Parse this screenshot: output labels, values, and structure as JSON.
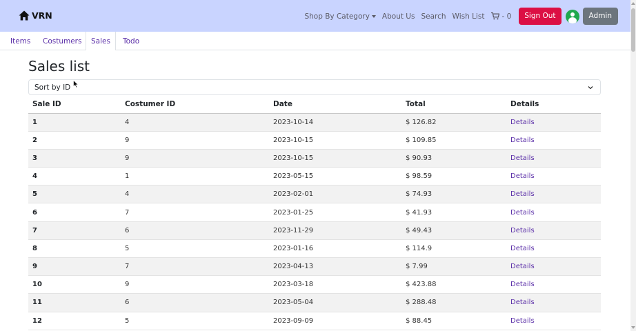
{
  "navbar": {
    "brand": "VRN",
    "shop_by_category": "Shop By Category",
    "about_us": "About Us",
    "search": "Search",
    "wish_list": "Wish List",
    "cart_count": "- 0",
    "sign_out": "Sign Out",
    "admin": "Admin"
  },
  "tabs": [
    "Items",
    "Costumers",
    "Sales",
    "Todo"
  ],
  "active_tab": "Sales",
  "page": {
    "title": "Sales list",
    "sort_selected": "Sort by ID"
  },
  "table": {
    "headers": [
      "Sale ID",
      "Costumer ID",
      "Date",
      "Total",
      "Details"
    ],
    "rows": [
      {
        "id": "1",
        "costumer": "4",
        "date": "2023-10-14",
        "total": "$ 126.82",
        "details": "Details"
      },
      {
        "id": "2",
        "costumer": "9",
        "date": "2023-10-15",
        "total": "$ 109.85",
        "details": "Details"
      },
      {
        "id": "3",
        "costumer": "9",
        "date": "2023-10-15",
        "total": "$ 90.93",
        "details": "Details"
      },
      {
        "id": "4",
        "costumer": "1",
        "date": "2023-05-15",
        "total": "$ 98.59",
        "details": "Details"
      },
      {
        "id": "5",
        "costumer": "4",
        "date": "2023-02-01",
        "total": "$ 74.93",
        "details": "Details"
      },
      {
        "id": "6",
        "costumer": "7",
        "date": "2023-01-25",
        "total": "$ 41.93",
        "details": "Details"
      },
      {
        "id": "7",
        "costumer": "6",
        "date": "2023-11-29",
        "total": "$ 49.43",
        "details": "Details"
      },
      {
        "id": "8",
        "costumer": "5",
        "date": "2023-01-16",
        "total": "$ 114.9",
        "details": "Details"
      },
      {
        "id": "9",
        "costumer": "7",
        "date": "2023-04-13",
        "total": "$ 7.99",
        "details": "Details"
      },
      {
        "id": "10",
        "costumer": "9",
        "date": "2023-03-18",
        "total": "$ 423.88",
        "details": "Details"
      },
      {
        "id": "11",
        "costumer": "6",
        "date": "2023-05-04",
        "total": "$ 288.48",
        "details": "Details"
      },
      {
        "id": "12",
        "costumer": "5",
        "date": "2023-09-09",
        "total": "$ 88.45",
        "details": "Details"
      }
    ]
  },
  "icons": {
    "home": "home-icon",
    "cart": "cart-icon",
    "user": "user-circle-icon",
    "chevron": "chevron-down-icon"
  },
  "colors": {
    "navbar_bg": "#c9d4ff",
    "sign_out_bg": "#dc0f44",
    "admin_bg": "#6c757d",
    "avatar": "#1fa84e",
    "link": "#5b2fa8"
  }
}
